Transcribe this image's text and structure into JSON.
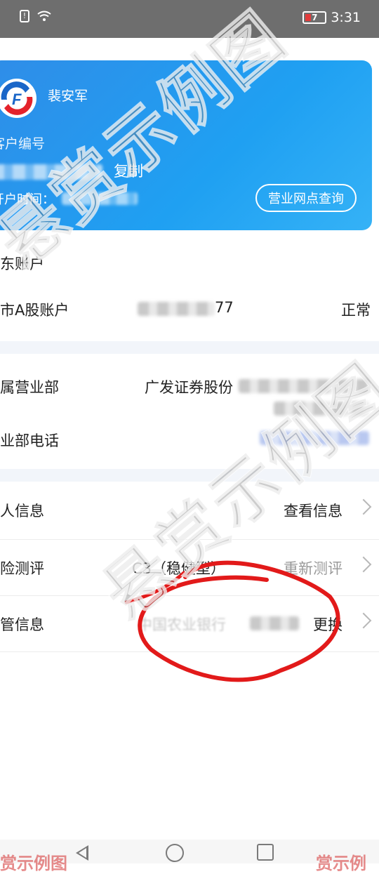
{
  "status_bar": {
    "time": "3:31",
    "battery_level": "7",
    "notification_glyph": "!"
  },
  "account_card": {
    "holder_name": "裴安军",
    "customer_no_label": "客户编号",
    "copy_label": "复制",
    "open_time_label": "开户时间：",
    "branch_query_button": "营业网点查询"
  },
  "shareholder_section": {
    "title": "东账户",
    "rows": [
      {
        "label": "市A股账户",
        "value_suffix": "77",
        "status": "正常"
      }
    ]
  },
  "branch_section": {
    "rows": [
      {
        "label": "属营业部",
        "value": "广发证券股份"
      },
      {
        "label": "业部电话"
      }
    ]
  },
  "info_section": {
    "rows": [
      {
        "label": "人信息",
        "action": "查看信息"
      },
      {
        "label": "险测评",
        "value": "C3（稳健型）",
        "action": "重新测评"
      },
      {
        "label": "管信息",
        "value": "中国农业银行",
        "action": "更换"
      }
    ]
  },
  "watermark": {
    "text": "悬赏示例图",
    "bottom_left": "赏示例图",
    "bottom_right": "赏示例"
  },
  "colors": {
    "card_gradient_start": "#2f8de8",
    "card_gradient_end": "#35b2f6",
    "status_bar_bg": "#6e6e6e",
    "annotation_red": "#e21a1a"
  },
  "icons": [
    "notification-icon",
    "wifi-icon",
    "battery-icon",
    "gf-logo-icon",
    "chevron-right-icon",
    "nav-back-icon",
    "nav-home-icon",
    "nav-recent-icon"
  ]
}
